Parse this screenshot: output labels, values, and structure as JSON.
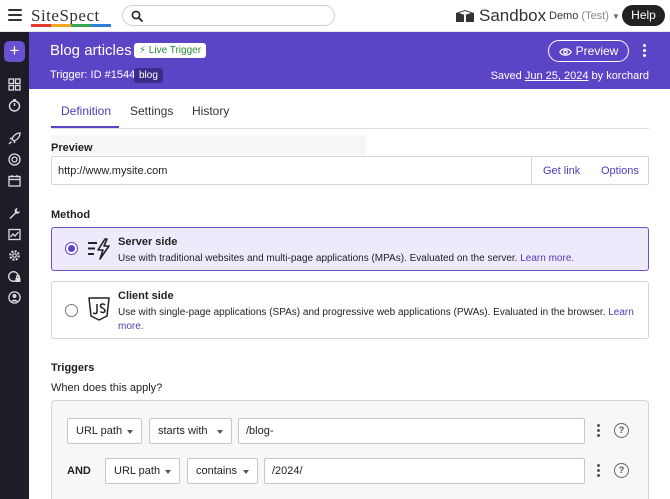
{
  "topbar": {
    "logo": "SiteSpect",
    "logo_colors": [
      "#e63b2e",
      "#f5a623",
      "#3aa655",
      "#2d7ed8"
    ],
    "search_placeholder": "",
    "workspace": "Sandbox",
    "account": "Demo",
    "account_env": "(Test)",
    "help_label": "Help"
  },
  "header": {
    "title": "Blog articles",
    "live_badge": "⚡ Live Trigger",
    "trigger_id": "Trigger: ID #1544",
    "tag": "blog",
    "preview_label": "Preview",
    "saved_prefix": "Saved",
    "saved_date": "Jun 25, 2024",
    "saved_suffix": "by korchard"
  },
  "tabs": [
    {
      "label": "Definition",
      "active": true
    },
    {
      "label": "Settings",
      "active": false
    },
    {
      "label": "History",
      "active": false
    }
  ],
  "preview": {
    "label": "Preview",
    "url": "http://www.mysite.com",
    "get_link": "Get link",
    "options": "Options"
  },
  "method": {
    "label": "Method",
    "options": [
      {
        "title": "Server side",
        "description": "Use with traditional websites and multi-page applications (MPAs). Evaluated on the server.",
        "learn_more": "Learn more.",
        "selected": true,
        "icon": "server-bolt-icon"
      },
      {
        "title": "Client side",
        "description": "Use with single-page applications (SPAs) and progressive web applications (PWAs). Evaluated in the browser.",
        "learn_more": "Learn more.",
        "selected": false,
        "icon": "js-shield-icon"
      }
    ]
  },
  "triggers": {
    "label": "Triggers",
    "question": "When does this apply?",
    "rules": [
      {
        "conjunction": "",
        "field": "URL path",
        "operator": "starts with",
        "value": "/blog-"
      },
      {
        "conjunction": "AND",
        "field": "URL path",
        "operator": "contains",
        "value": "/2024/"
      }
    ]
  },
  "colors": {
    "accent": "#5b45c6",
    "rail": "#1d1d28",
    "live_green": "#2a8a3e",
    "link": "#4f3bb8"
  }
}
